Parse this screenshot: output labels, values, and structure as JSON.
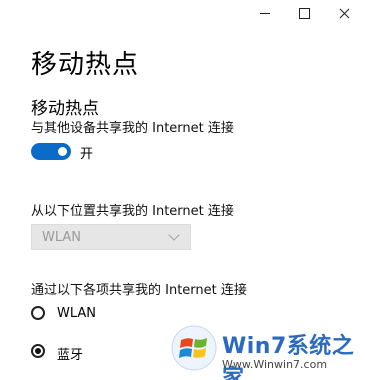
{
  "window": {
    "controls": {
      "minimize_icon": "minimize-icon",
      "maximize_icon": "maximize-icon",
      "close_icon": "close-icon"
    }
  },
  "page": {
    "title": "移动热点"
  },
  "hotspot": {
    "heading": "移动热点",
    "share_description": "与其他设备共享我的 Internet 连接",
    "toggle_state_label": "开",
    "toggle_on": true
  },
  "share_from": {
    "label": "从以下位置共享我的 Internet 连接",
    "selected": "WLAN"
  },
  "share_over": {
    "label": "通过以下各项共享我的 Internet 连接",
    "options": [
      {
        "label": "WLAN",
        "checked": false
      },
      {
        "label": "蓝牙",
        "checked": true
      }
    ]
  },
  "watermark": {
    "brand": "Win7系统之家",
    "url": "Www.Winwin7.com"
  },
  "colors": {
    "accent": "#0a6cc8",
    "disabled_bg": "#e6e6e6",
    "disabled_text": "#9a9a9a"
  }
}
